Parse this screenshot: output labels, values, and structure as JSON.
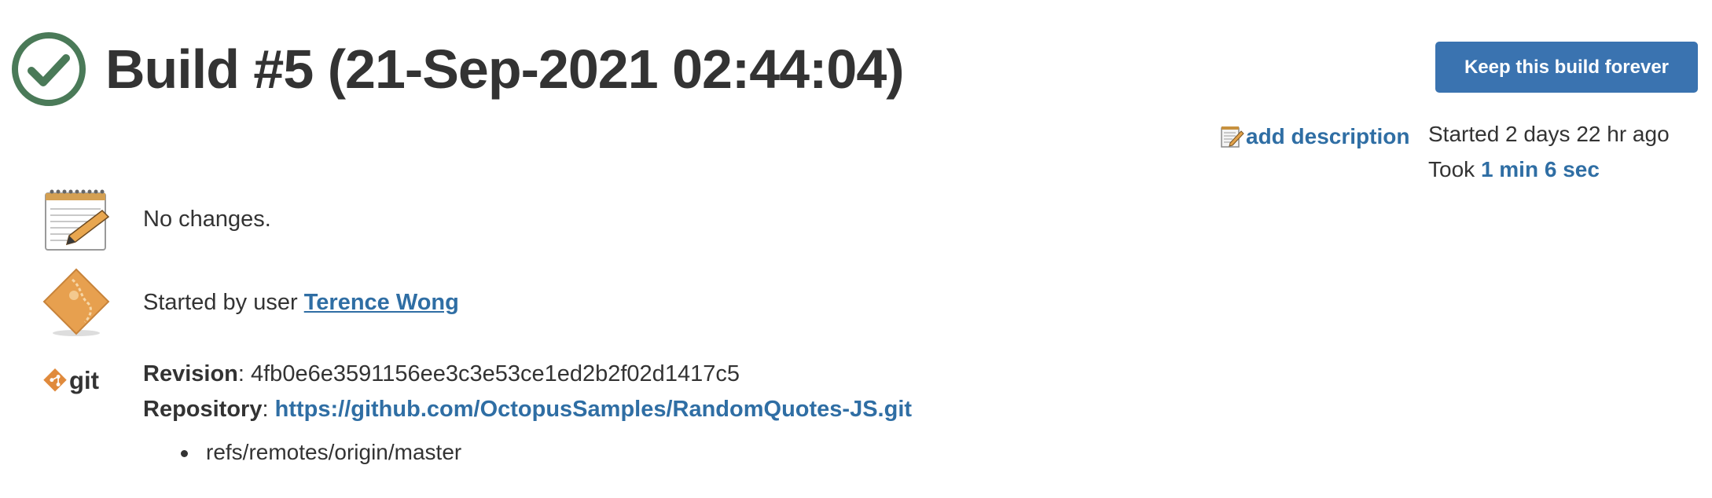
{
  "header": {
    "title": "Build #5 (21-Sep-2021 02:44:04)",
    "status_icon": "success-check-icon",
    "keep_button_label": "Keep this build forever"
  },
  "description": {
    "link_label": "add description",
    "icon": "notepad-edit-icon"
  },
  "build_info": {
    "started_text": "Started 2 days 22 hr ago",
    "took_prefix": "Took ",
    "duration": "1 min 6 sec"
  },
  "changes": {
    "text": "No changes.",
    "icon": "notepad-icon"
  },
  "cause": {
    "prefix": "Started by user ",
    "user": "Terence Wong",
    "icon": "user-diamond-icon"
  },
  "git": {
    "icon": "git-logo-icon",
    "logo_text": "git",
    "revision_label": "Revision",
    "revision_value": "4fb0e6e3591156ee3c3e53ce1ed2b2f02d1417c5",
    "repository_label": "Repository",
    "repository_url": "https://github.com/OctopusSamples/RandomQuotes-JS.git",
    "branches": [
      "refs/remotes/origin/master"
    ]
  },
  "colors": {
    "accent": "#3a73b0",
    "link": "#2f6ea4",
    "success": "#4a7a58",
    "text": "#333333"
  }
}
